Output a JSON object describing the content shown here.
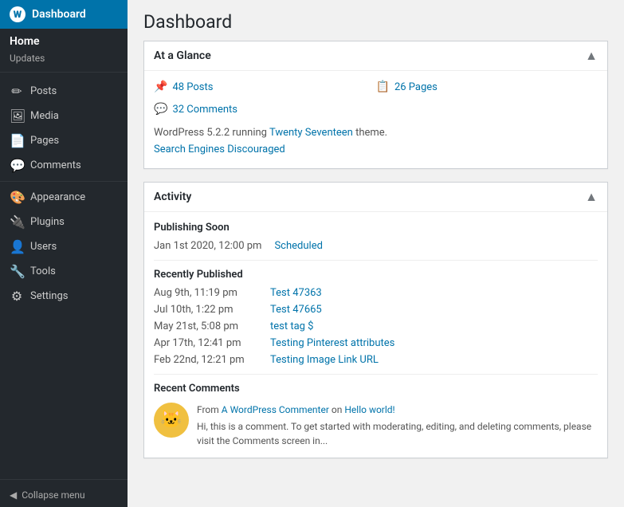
{
  "sidebar": {
    "header": {
      "title": "Dashboard",
      "icon": "W"
    },
    "home_section": {
      "title": "Home",
      "sub_items": [
        "Updates"
      ]
    },
    "items": [
      {
        "id": "posts",
        "label": "Posts",
        "icon": "✏"
      },
      {
        "id": "media",
        "label": "Media",
        "icon": "🖼"
      },
      {
        "id": "pages",
        "label": "Pages",
        "icon": "📄"
      },
      {
        "id": "comments",
        "label": "Comments",
        "icon": "💬"
      },
      {
        "id": "appearance",
        "label": "Appearance",
        "icon": "🎨"
      },
      {
        "id": "plugins",
        "label": "Plugins",
        "icon": "🔌"
      },
      {
        "id": "users",
        "label": "Users",
        "icon": "👤"
      },
      {
        "id": "tools",
        "label": "Tools",
        "icon": "🔧"
      },
      {
        "id": "settings",
        "label": "Settings",
        "icon": "⚙"
      }
    ],
    "collapse_label": "Collapse menu"
  },
  "page": {
    "title": "Dashboard"
  },
  "at_a_glance": {
    "title": "At a Glance",
    "stats": [
      {
        "icon": "📌",
        "value": "48 Posts"
      },
      {
        "icon": "📋",
        "value": "26 Pages"
      },
      {
        "icon": "💬",
        "value": "32 Comments"
      }
    ],
    "wp_info": "WordPress 5.2.2 running ",
    "theme_link": "Twenty Seventeen",
    "theme_suffix": " theme.",
    "search_engines": "Search Engines Discouraged"
  },
  "activity": {
    "title": "Activity",
    "publishing_soon_label": "Publishing Soon",
    "scheduled_item": {
      "date": "Jan 1st 2020, 12:00 pm",
      "status": "Scheduled"
    },
    "recently_published_label": "Recently Published",
    "published_items": [
      {
        "date": "Aug 9th, 11:19 pm",
        "title": "Test 47363"
      },
      {
        "date": "Jul 10th, 1:22 pm",
        "title": "Test 47665"
      },
      {
        "date": "May 21st, 5:08 pm",
        "title": "test tag $"
      },
      {
        "date": "Apr 17th, 12:41 pm",
        "title": "Testing Pinterest attributes"
      },
      {
        "date": "Feb 22nd, 12:21 pm",
        "title": "Testing Image Link URL"
      }
    ],
    "recent_comments_label": "Recent Comments",
    "comment": {
      "from_prefix": "From ",
      "commenter": "A WordPress Commenter",
      "on_text": " on ",
      "post_link": "Hello world!",
      "body": "Hi, this is a comment. To get started with moderating, editing, and deleting comments, please visit the Comments screen in..."
    }
  }
}
